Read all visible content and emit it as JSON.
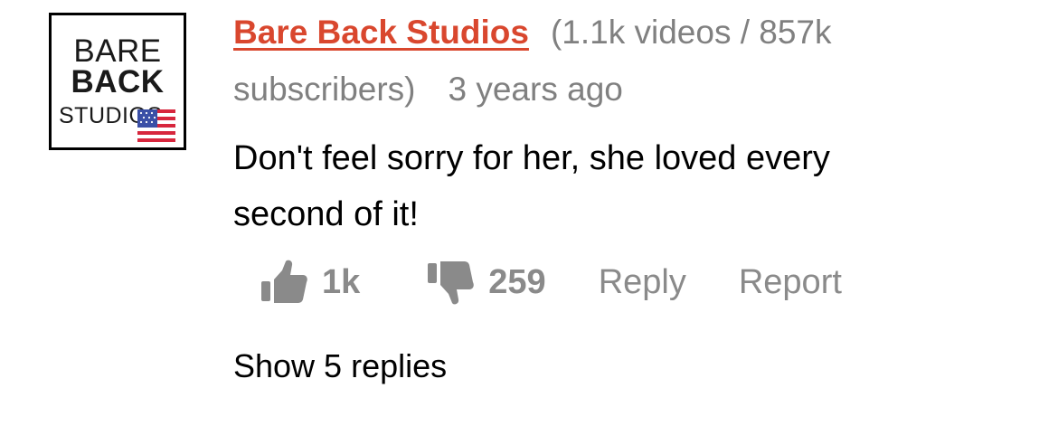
{
  "comment": {
    "avatar": {
      "line1": "BARE",
      "line2": "BACK",
      "line3": "STUDIOS",
      "badge": "flag-icon"
    },
    "username": "Bare Back Studios",
    "stats": "(1.1k videos / 857k subscribers)",
    "time_ago": "3 years ago",
    "text": "Don't feel sorry for her, she loved every second of it!",
    "likes": "1k",
    "dislikes": "259",
    "reply_label": "Reply",
    "report_label": "Report",
    "show_replies_label": "Show 5 replies"
  },
  "colors": {
    "username": "#d9472e",
    "muted": "#808080",
    "text": "#000000"
  }
}
